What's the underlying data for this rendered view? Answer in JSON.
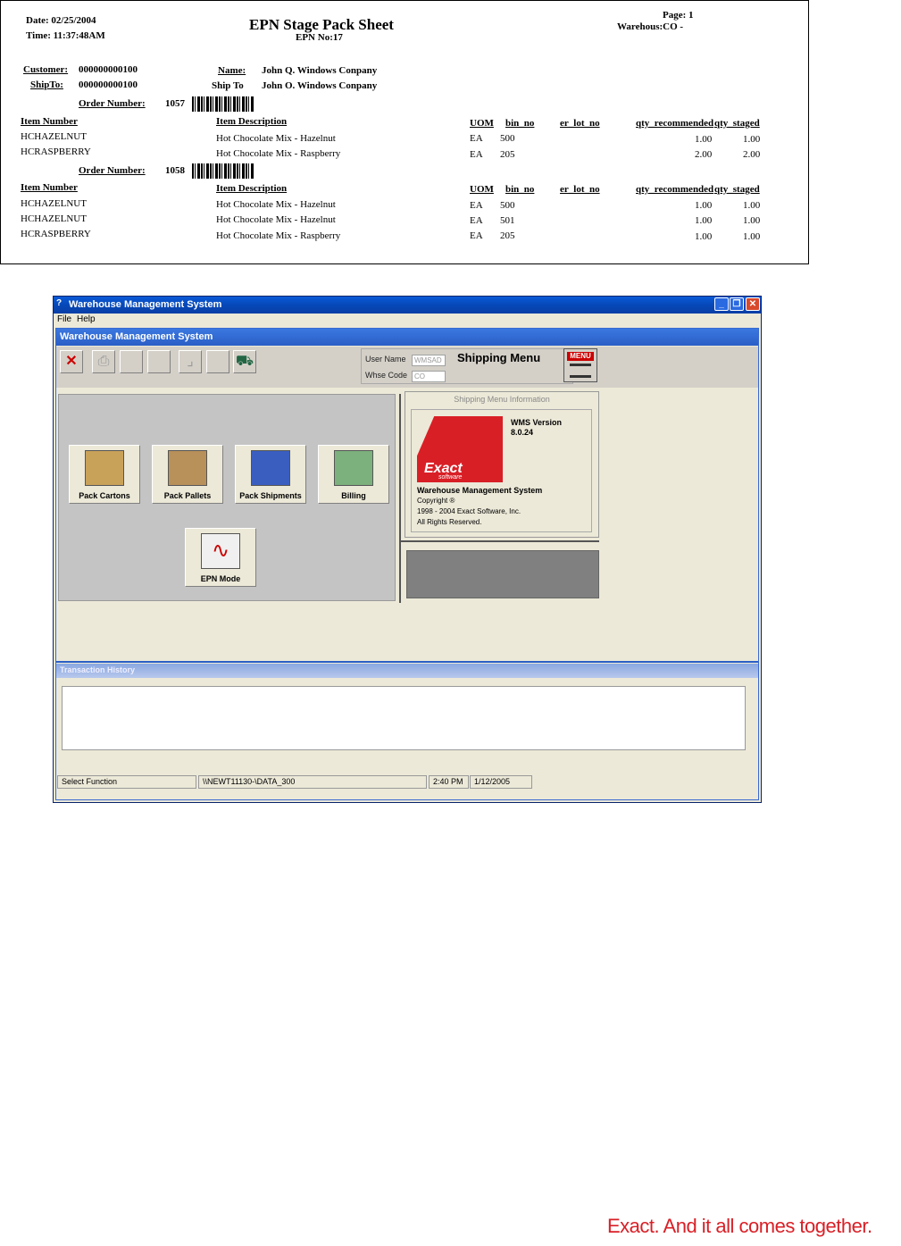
{
  "sheet": {
    "date": "Date: 02/25/2004",
    "time": "Time: 11:37:48AM",
    "title": "EPN Stage Pack Sheet",
    "epn_no": "EPN No:17",
    "page": "Page: 1",
    "warehouse": "Warehous:CO -",
    "customer_label": "Customer:",
    "customer_value": "000000000100",
    "shipto_label": "ShipTo:",
    "shipto_value": "000000000100",
    "name_label": "Name:",
    "name_value": "John Q. Windows Conpany",
    "shipto_name_label": "Ship To",
    "shipto_name_value": "John O. Windows Conpany",
    "columns": [
      "Item Number",
      "Item Description",
      "UOM",
      "bin_no",
      "er_lot_no",
      "qty_recommended",
      "qty_staged"
    ],
    "orders": [
      {
        "label": "Order Number:",
        "number": "1057",
        "rows": [
          {
            "item": "HCHAZELNUT",
            "desc": "Hot Chocolate Mix - Hazelnut",
            "uom": "EA",
            "bin": "500",
            "qty_rec": "1.00",
            "qty_staged": "1.00"
          },
          {
            "item": "HCRASPBERRY",
            "desc": "Hot Chocolate Mix - Raspberry",
            "uom": "EA",
            "bin": "205",
            "qty_rec": "2.00",
            "qty_staged": "2.00"
          }
        ]
      },
      {
        "label": "Order Number:",
        "number": "1058",
        "rows": [
          {
            "item": "HCHAZELNUT",
            "desc": "Hot Chocolate Mix - Hazelnut",
            "uom": "EA",
            "bin": "500",
            "qty_rec": "1.00",
            "qty_staged": "1.00"
          },
          {
            "item": "HCHAZELNUT",
            "desc": "Hot Chocolate Mix - Hazelnut",
            "uom": "EA",
            "bin": "501",
            "qty_rec": "1.00",
            "qty_staged": "1.00"
          },
          {
            "item": "HCRASPBERRY",
            "desc": "Hot Chocolate Mix - Raspberry",
            "uom": "EA",
            "bin": "205",
            "qty_rec": "1.00",
            "qty_staged": "1.00"
          }
        ]
      }
    ]
  },
  "window": {
    "title": "Warehouse Management System",
    "menu": [
      "File",
      "Help"
    ],
    "inner_title": "Warehouse Management System",
    "user_name_label": "User Name",
    "user_name_value": "WMSAD",
    "whse_code_label": "Whse Code",
    "whse_code_value": "CO",
    "screen_title": "Shipping Menu",
    "menu_icon_text": "MENU",
    "buttons": {
      "pack_cartons": "Pack Cartons",
      "pack_pallets": "Pack Pallets",
      "pack_shipments": "Pack Shipments",
      "billing": "Billing",
      "epn_mode": "EPN Mode"
    },
    "info": {
      "title": "Shipping Menu Information",
      "version_label": "WMS Version",
      "version": "8.0.24",
      "logo_text": "Exact",
      "logo_sub": "software",
      "product": "Warehouse Management System",
      "copyright": "Copyright ®",
      "years": "1998 - 2004 Exact Software, Inc.",
      "rights": "All Rights Reserved."
    },
    "history_title": "Transaction History",
    "status": {
      "function": "Select Function",
      "path": "\\\\NEWT11130-\\DATA_300",
      "time": "2:40 PM",
      "date": "1/12/2005"
    }
  },
  "footer": {
    "tagline": "Exact. And it all comes together."
  },
  "colors": {
    "titlebar": "#0a5ad8",
    "panel": "#ece9d8",
    "logo_red": "#d91f26",
    "tagline": "#d91f26"
  }
}
